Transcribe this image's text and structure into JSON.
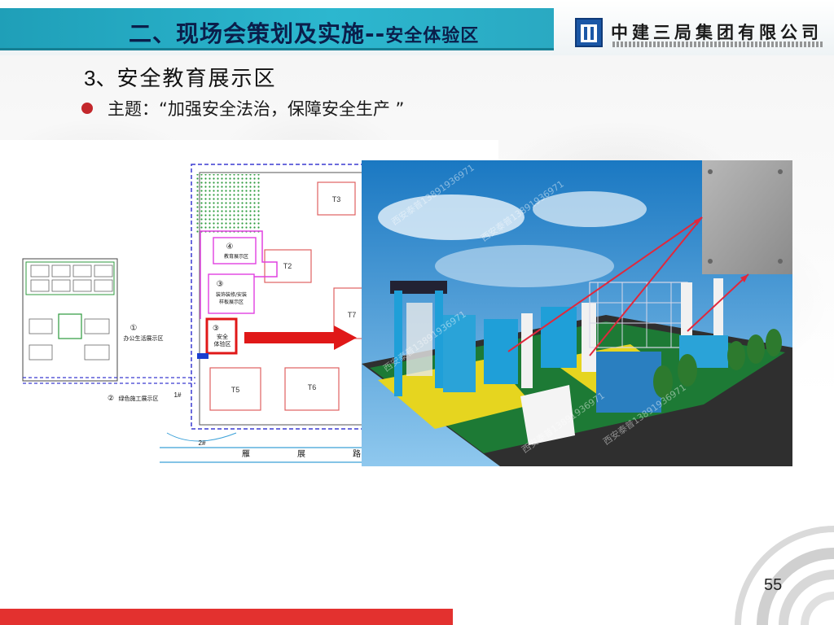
{
  "header": {
    "title_main": "二、现场会策划及实施--",
    "title_suffix": "安全体验区",
    "company_name": "中建三局集团有限公司"
  },
  "section": {
    "heading_number": "3、",
    "heading_text": "安全教育展示区",
    "bullet_label": "主题：",
    "bullet_quote": "“加强安全法治，保障安全生产 ”"
  },
  "plan": {
    "labels": {
      "t3": "T3",
      "t2": "T2",
      "t7": "T7",
      "t5": "T5",
      "t6": "T6",
      "zone4_num": "④",
      "zone4_label": "教育展示区",
      "zone3_num": "③",
      "zone3_label_1": "装饰装修/安装",
      "zone3_label_2": "样板展示区",
      "zone_safety_num": "③",
      "zone_safety_1": "安全",
      "zone_safety_2": "体验区",
      "office_num": "①",
      "office_label": "办公生活展示区",
      "green_num": "②",
      "green_label": "绿色施工展示区",
      "gate1": "1#",
      "gate2": "2#",
      "road_1": "雁",
      "road_2": "展",
      "road_3": "路"
    }
  },
  "render": {
    "watermark": "西安泰普13891936971"
  },
  "page_number": "55",
  "colors": {
    "title_bar": "#2cb7cf",
    "title_text": "#0b1e4a",
    "bullet": "#c3272b",
    "bottom_bar": "#e3312f",
    "logo_blue": "#1b57a6"
  }
}
